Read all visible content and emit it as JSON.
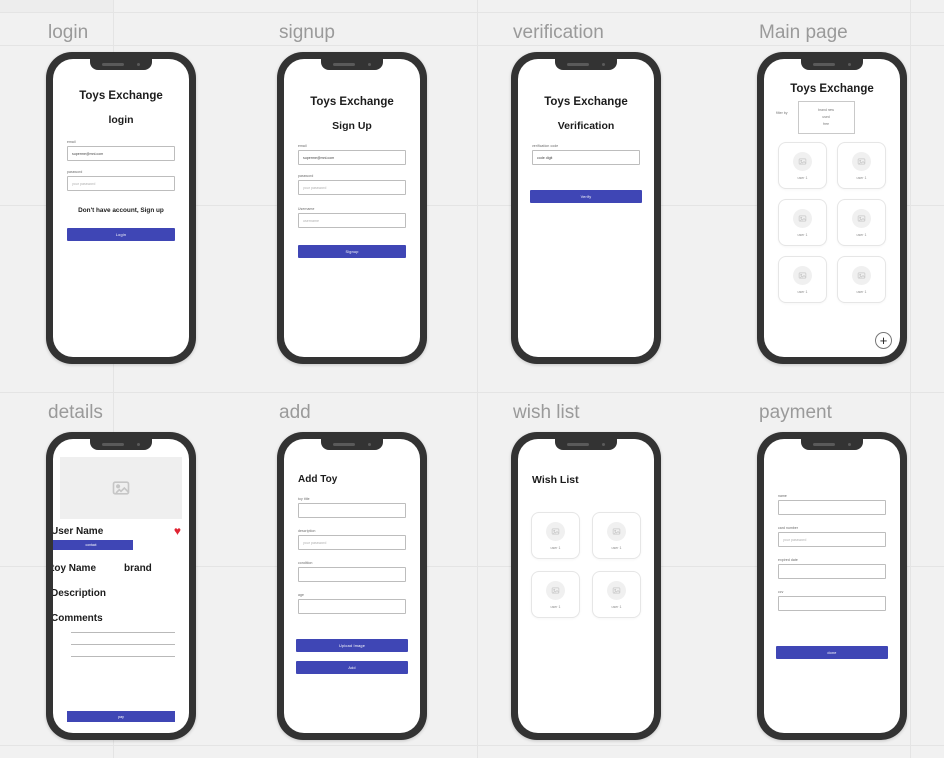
{
  "theme": {
    "background": "#f1f1f1",
    "grid_line": "#e4e4e4",
    "phone_body": "#333333",
    "accent": "#3f46b5",
    "heart": "#e02433",
    "muted_text": "#8d8d8d"
  },
  "frames": [
    {
      "label": "login",
      "app_title": "Toys Exchange",
      "page_title": "login",
      "fields": [
        {
          "label": "email",
          "value": "superme@mni.com",
          "placeholder": ""
        },
        {
          "label": "password",
          "value": "",
          "placeholder": "your password"
        }
      ],
      "hint": "Don't have account, Sign up",
      "button": "Login"
    },
    {
      "label": "signup",
      "app_title": "Toys Exchange",
      "page_title": "Sign Up",
      "fields": [
        {
          "label": "email",
          "value": "superme@mni.com",
          "placeholder": ""
        },
        {
          "label": "password",
          "value": "",
          "placeholder": "your password"
        },
        {
          "label": "Username",
          "value": "",
          "placeholder": "username"
        }
      ],
      "button": "Signup"
    },
    {
      "label": "verification",
      "app_title": "Toys Exchange",
      "page_title": "Verification",
      "fields": [
        {
          "label": "verification code",
          "value": "code digit",
          "placeholder": ""
        }
      ],
      "button": "Verify"
    },
    {
      "label": "Main page",
      "app_title": "Toys Exchange",
      "filter_label": "filter by",
      "filter_options": [
        "brand new",
        "used",
        "free"
      ],
      "cards": [
        {
          "caption": "user 1"
        },
        {
          "caption": "user 1"
        },
        {
          "caption": "user 1"
        },
        {
          "caption": "user 1"
        },
        {
          "caption": "user 1"
        },
        {
          "caption": "user 1"
        }
      ],
      "fab": "+"
    },
    {
      "label": "details",
      "user_name": "User Name",
      "heart": "♥",
      "contact_button": "contact",
      "toy_name": "toy Name",
      "brand": "brand",
      "description_heading": "Description",
      "comments_heading": "Comments",
      "comment_lines": 3,
      "pay_button": "pay"
    },
    {
      "label": "add",
      "page_title": "Add Toy",
      "fields": [
        {
          "label": "toy title",
          "value": "",
          "placeholder": ""
        },
        {
          "label": "description",
          "value": "",
          "placeholder": "your password"
        },
        {
          "label": "condition",
          "value": "",
          "placeholder": ""
        },
        {
          "label": "age",
          "value": "",
          "placeholder": ""
        }
      ],
      "upload_button": "Upload Image",
      "add_button": "Add"
    },
    {
      "label": "wish list",
      "page_title": "Wish List",
      "cards": [
        {
          "caption": "user 1"
        },
        {
          "caption": "user 1"
        },
        {
          "caption": "user 1"
        },
        {
          "caption": "user 1"
        }
      ]
    },
    {
      "label": "payment",
      "fields": [
        {
          "label": "name",
          "value": "",
          "placeholder": ""
        },
        {
          "label": "card number",
          "value": "",
          "placeholder": "your password"
        },
        {
          "label": "expired date",
          "value": "",
          "placeholder": ""
        },
        {
          "label": "ccv",
          "value": "",
          "placeholder": ""
        }
      ],
      "button": "done"
    }
  ]
}
